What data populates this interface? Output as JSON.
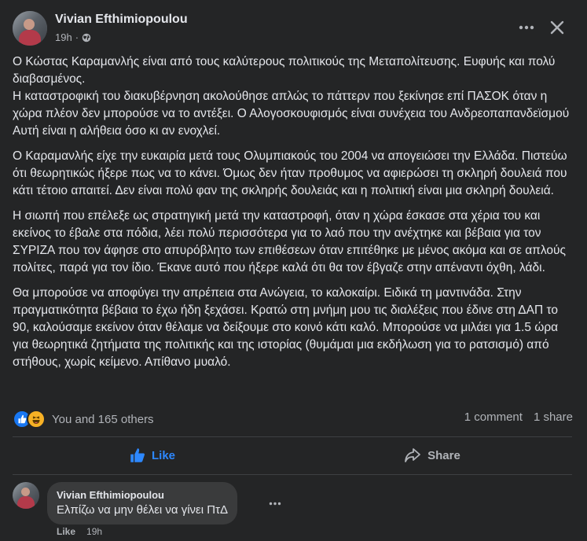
{
  "post": {
    "author": "Vivian Efthimiopoulou",
    "time": "19h",
    "privacy_icon": "globe-icon",
    "paragraphs": [
      "Ο Κώστας Καραμανλής είναι από τους καλύτερους πολιτικούς της Μεταπολίτευσης. Ευφυής και πολύ διαβασμένος.\nΗ καταστροφική του διακυβέρνηση ακολούθησε απλώς το πάττερν που ξεκίνησε επί ΠΑΣΟΚ όταν η χώρα πλέον δεν μπορούσε να το αντέξει. Ο Αλογοσκουφισμός είναι συνέχεια του Ανδρεοπαπανδεϊσμού Αυτή είναι η αλήθεια όσο κι αν ενοχλεί.",
      "Ο Καραμανλής είχε την ευκαιρία μετά τους Ολυμπιακούς του 2004 να απογειώσει την Ελλάδα. Πιστεύω ότι θεωρητικώς ήξερε πως να το κάνει. Όμως δεν ήταν προθυμος να αφιερώσει τη σκληρή δουλειά που κάτι τέτοιο απαιτεί. Δεν είναι πολύ φαν της σκληρής δουλειάς και η πολιτική είναι μια σκληρή δουλειά.",
      "Η σιωπή που επέλεξε ως στρατηγική μετά την καταστροφή, όταν η χώρα έσκασε στα χέρια του και εκείνος το έβαλε στα πόδια, λέει πολύ περισσότερα για το λαό που την ανέχτηκε και βέβαια για τον ΣΥΡΙΖΑ που τον άφησε στο απυρόβλητο των επιθέσεων όταν επιτέθηκε με μένος ακόμα και σε απλούς πολίτες, παρά για τον ίδιο. Έκανε αυτό που ήξερε καλά ότι θα τον έβγαζε στην απέναντι όχθη, λάδι.",
      "Θα μπορούσε να αποφύγει την απρέπεια στα Ανώγεια, το καλοκαίρι. Ειδικά τη μαντινάδα. Στην πραγματικότητα βέβαια το έχω ήδη ξεχάσει. Κρατώ στη μνήμη μου τις διαλέξεις που έδινε στη ΔΑΠ το 90, καλούσαμε εκείνον όταν θέλαμε να δείξουμε στο κοινό κάτι καλό. Μπορούσε να μιλάει για 1.5 ώρα για θεωρητικά ζητήματα της πολιτικής και της ιστορίας (θυμάμαι  μια εκδήλωση για το ρατσισμό) από στήθους, χωρίς κείμενο. Απίθανο μυαλό."
    ],
    "reactions_text": "You and 165 others",
    "comments_count": "1 comment",
    "shares_count": "1 share"
  },
  "actions": {
    "like_label": "Like",
    "share_label": "Share"
  },
  "comment": {
    "author": "Vivian Efthimiopoulou",
    "text": "Ελπίζω να μην θέλει να γίνει ΠτΔ",
    "like_label": "Like",
    "time": "19h"
  },
  "colors": {
    "background": "#242526",
    "text": "#e4e6eb",
    "secondary": "#b0b3b8",
    "accent": "#2d88ff",
    "bubble": "#3a3b3c"
  }
}
